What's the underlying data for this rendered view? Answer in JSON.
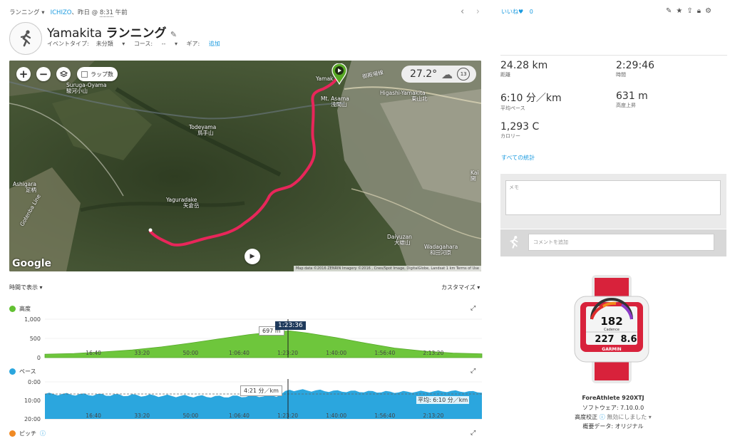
{
  "header": {
    "activity_type_label": "ランニング",
    "user": "ICHIZO",
    "date_prefix": "、昨日 @",
    "time": "8:31",
    "time_suffix": "午前",
    "title_place": "Yamakita",
    "title_type": "ランニング",
    "event_type_label": "イベントタイプ:",
    "event_type_value": "未分類",
    "course_label": "コース:",
    "course_value": "--",
    "gear_label": "ギア:",
    "gear_value": "追加",
    "prev_icon": "chevron-left",
    "next_icon": "chevron-right"
  },
  "map": {
    "zoom_in": "+",
    "zoom_out": "−",
    "lap_label": "ラップ数",
    "temperature": "27.2°",
    "wind": "13",
    "google": "Google",
    "credit": "Map data ©2016 ZENRIN Imagery ©2016 , Cnes/Spot Image, DigitalGlobe, Landsat    1 km    Terms of Use",
    "labels": {
      "suruga": "Suruga-Oyama",
      "suruga_jp": "駿河小山",
      "yamakita": "Yamak",
      "gotemba": "御殿場線",
      "asama": "Mt. Asama",
      "asama_jp": "浅間山",
      "higashi": "Higashi-Yamakita",
      "higashi_jp": "東山北",
      "todeyama": "Todeyama",
      "todeyama_jp": "鳥手山",
      "yaguradake": "Yaguradake",
      "yaguradake_jp": "矢倉岳",
      "ashigara": "Ashigara",
      "ashigara_jp": "足柄",
      "gotenba_line": "Gotenba Line",
      "daiyuzan": "Daiyuzan",
      "daiyuzan_jp": "大雄山",
      "wadagahara": "Wadagahara",
      "wadagahara_jp": "和田河原",
      "kai": "Kai",
      "kai_jp": "開"
    }
  },
  "charts": {
    "view_by": "時間で表示",
    "customize": "カスタマイズ",
    "elevation_label": "高度",
    "pace_label": "ペース",
    "pitch_label": "ピッチ",
    "cursor_time": "1:23:36",
    "elev_tooltip": "697 m",
    "pace_tooltip": "4:21 分／km",
    "avg_pace": "平均: 6:10 分／km",
    "x_ticks": [
      "16:40",
      "33:20",
      "50:00",
      "1:06:40",
      "1:23:20",
      "1:40:00",
      "1:56:40",
      "2:13:20"
    ],
    "elev_y_ticks": [
      "1,000",
      "500",
      "0"
    ],
    "pace_y_ticks": [
      "0:00",
      "10:00",
      "20:00"
    ],
    "elev_color": "#62c132",
    "pace_color": "#2ba6de",
    "pitch_color": "#f08a24"
  },
  "chart_data": [
    {
      "type": "area",
      "title": "高度",
      "x_ticks": [
        "16:40",
        "33:20",
        "50:00",
        "1:06:40",
        "1:23:20",
        "1:40:00",
        "1:56:40",
        "2:13:20"
      ],
      "ylim": [
        0,
        1000
      ],
      "x_minutes": [
        0,
        10,
        20,
        30,
        40,
        50,
        60,
        70,
        80,
        84,
        90,
        100,
        110,
        120,
        130,
        140,
        150
      ],
      "values": [
        90,
        110,
        150,
        200,
        280,
        380,
        490,
        600,
        680,
        697,
        640,
        520,
        380,
        250,
        170,
        120,
        100
      ]
    },
    {
      "type": "area",
      "title": "ペース",
      "x_ticks": [
        "16:40",
        "33:20",
        "50:00",
        "1:06:40",
        "1:23:20",
        "1:40:00",
        "1:56:40",
        "2:13:20"
      ],
      "ylim": [
        "0:00",
        "20:00"
      ],
      "x_minutes": [
        0,
        20,
        40,
        60,
        80,
        84,
        100,
        120,
        140,
        150
      ],
      "values": [
        "6:30",
        "7:00",
        "7:30",
        "8:00",
        "7:30",
        "4:21",
        "5:00",
        "5:30",
        "5:00",
        "5:30"
      ],
      "avg": "6:10"
    }
  ],
  "stats": [
    {
      "value": "24.28 km",
      "label": "距離"
    },
    {
      "value": "2:29:46",
      "label": "時間"
    },
    {
      "value": "6:10 分／km",
      "label": "平均ペース"
    },
    {
      "value": "631 m",
      "label": "高度上昇"
    },
    {
      "value": "1,293 C",
      "label": "カロリー"
    }
  ],
  "right": {
    "like_label": "いいね",
    "like_count": "0",
    "all_stats": "すべての統計",
    "memo_placeholder": "メモ",
    "comment_placeholder": "コメントを追加"
  },
  "device": {
    "name": "ForeAthlete 920XTJ",
    "software_label": "ソフトウェア:",
    "software_value": "7.10.0.0",
    "calibration_label": "高度校正",
    "calibration_value": "無効にしました",
    "source_label": "概要データ:",
    "source_value": "オリジナル",
    "screen_top": "182",
    "screen_label": "Cadence",
    "screen_left": "227",
    "screen_right": "8.6",
    "brand": "GARMIN"
  }
}
